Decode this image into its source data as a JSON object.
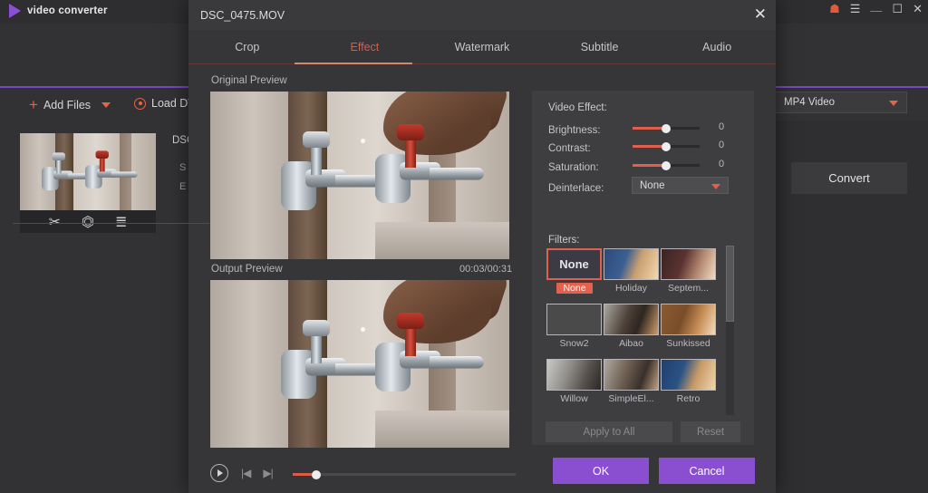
{
  "background_app": {
    "logo_text": "video converter",
    "window_controls": [
      {
        "name": "gift-icon",
        "glyph": "☗"
      },
      {
        "name": "menu-icon",
        "glyph": "☰"
      },
      {
        "name": "minimize-icon",
        "glyph": "＿"
      },
      {
        "name": "maximize-icon",
        "glyph": "☐"
      },
      {
        "name": "close-icon",
        "glyph": "✕"
      }
    ],
    "toolbar": {
      "add_files_label": "Add Files",
      "load_dvd_label": "Load DV"
    },
    "file_item": {
      "name_partial": "DSC",
      "meta_line1": "S",
      "meta_line2": "E",
      "actions": [
        "trim-icon",
        "crop-icon",
        "effect-icon"
      ]
    },
    "output_format": "MP4 Video",
    "convert_label": "Convert"
  },
  "dialog": {
    "title": "DSC_0475.MOV",
    "close_glyph": "✕",
    "tabs": [
      {
        "label": "Crop",
        "active": false
      },
      {
        "label": "Effect",
        "active": true
      },
      {
        "label": "Watermark",
        "active": false
      },
      {
        "label": "Subtitle",
        "active": false
      },
      {
        "label": "Audio",
        "active": false
      }
    ],
    "preview": {
      "original_label": "Original Preview",
      "output_label": "Output Preview",
      "time": "00:03/00:31"
    },
    "playback": {
      "play_icon": "play-icon",
      "prev_frame_glyph": "|◀",
      "next_frame_glyph": "▶|",
      "progress_percent": 10
    },
    "effects": {
      "section_title": "Video Effect:",
      "controls": [
        {
          "label": "Brightness:",
          "value": "0",
          "percent": 50
        },
        {
          "label": "Contrast:",
          "value": "0",
          "percent": 50
        },
        {
          "label": "Saturation:",
          "value": "0",
          "percent": 50
        }
      ],
      "deinterlace_label": "Deinterlace:",
      "deinterlace_value": "None"
    },
    "filters": {
      "section_title": "Filters:",
      "items": [
        {
          "name": "None",
          "selected": true
        },
        {
          "name": "Holiday",
          "selected": false
        },
        {
          "name": "Septem...",
          "selected": false
        },
        {
          "name": "Snow2",
          "selected": false
        },
        {
          "name": "Aibao",
          "selected": false
        },
        {
          "name": "Sunkissed",
          "selected": false
        },
        {
          "name": "Willow",
          "selected": false
        },
        {
          "name": "SimpleEl...",
          "selected": false
        },
        {
          "name": "Retro",
          "selected": false
        }
      ],
      "scroll_percent": 45
    },
    "buttons": {
      "apply_all": "Apply to All",
      "reset": "Reset",
      "ok": "OK",
      "cancel": "Cancel"
    }
  },
  "colors": {
    "accent_red": "#e0604d",
    "accent_purple": "#8a4fd0",
    "dialog_bg": "#363537",
    "panel_bg": "#3e3d40",
    "app_bg": "#323133"
  }
}
